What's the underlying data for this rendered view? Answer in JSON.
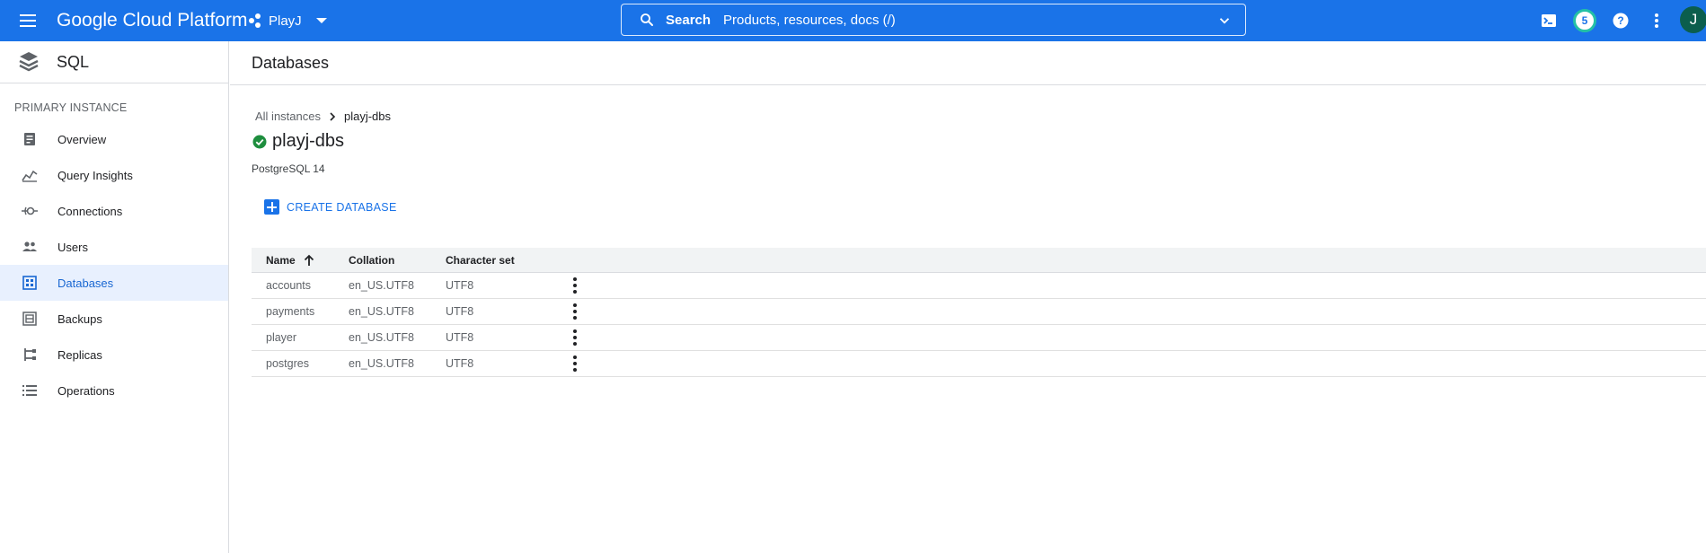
{
  "topbar": {
    "brand": "Google Cloud Platform",
    "project": "PlayJ",
    "search_label": "Search",
    "search_hint": "Products, resources, docs (/)",
    "notification_count": "5",
    "avatar_initial": "J",
    "colors": {
      "bar": "#1a73e8",
      "badge_ring": "#24c1a6",
      "avatar": "#0b5e4d"
    }
  },
  "sidebar": {
    "product": "SQL",
    "section": "PRIMARY INSTANCE",
    "items": [
      {
        "label": "Overview",
        "icon": "overview-icon"
      },
      {
        "label": "Query Insights",
        "icon": "insights-icon"
      },
      {
        "label": "Connections",
        "icon": "connections-icon"
      },
      {
        "label": "Users",
        "icon": "users-icon"
      },
      {
        "label": "Databases",
        "icon": "databases-icon",
        "active": true
      },
      {
        "label": "Backups",
        "icon": "backups-icon"
      },
      {
        "label": "Replicas",
        "icon": "replicas-icon"
      },
      {
        "label": "Operations",
        "icon": "operations-icon"
      }
    ]
  },
  "main": {
    "title": "Databases",
    "breadcrumb": {
      "parent": "All instances",
      "current": "playj-dbs"
    },
    "instance_name": "playj-dbs",
    "instance_version": "PostgreSQL 14",
    "create_label": "CREATE DATABASE",
    "table": {
      "columns": [
        "Name",
        "Collation",
        "Character set"
      ],
      "rows": [
        [
          "accounts",
          "en_US.UTF8",
          "UTF8"
        ],
        [
          "payments",
          "en_US.UTF8",
          "UTF8"
        ],
        [
          "player",
          "en_US.UTF8",
          "UTF8"
        ],
        [
          "postgres",
          "en_US.UTF8",
          "UTF8"
        ]
      ]
    }
  }
}
